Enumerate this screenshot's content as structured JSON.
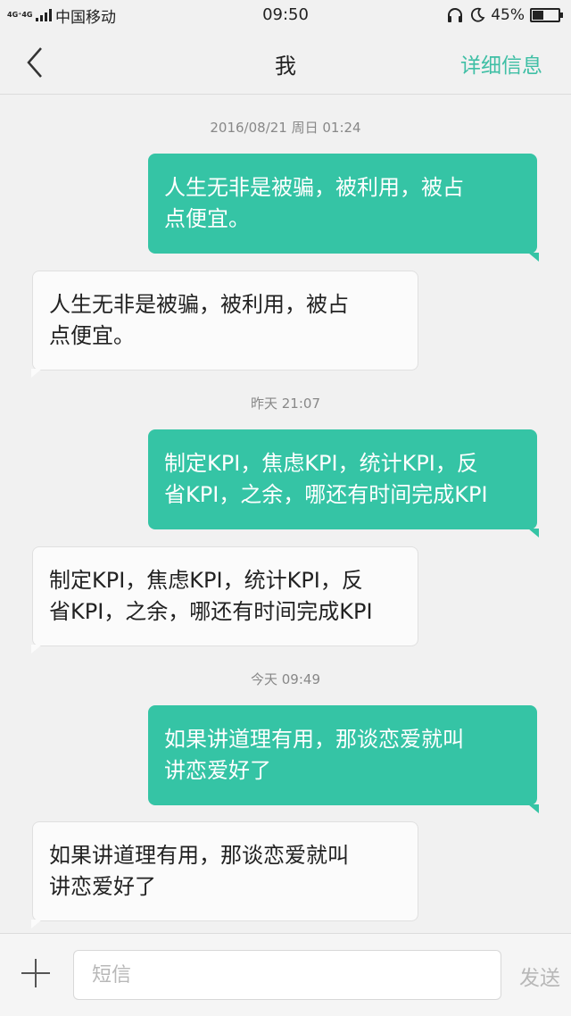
{
  "status_bar": {
    "network": "4G⁺4G",
    "carrier": "中国移动",
    "time": "09:50",
    "battery_percent": "45%",
    "battery_level": 0.45
  },
  "header": {
    "title": "我",
    "detail_label": "详细信息"
  },
  "conversation": [
    {
      "timestamp": "2016/08/21 周日  01:24",
      "sent": [
        "人生无非是被骗，被利用，被占",
        "点便宜。"
      ],
      "received": [
        "人生无非是被骗，被利用，被占",
        "点便宜。"
      ]
    },
    {
      "timestamp": "昨天  21:07",
      "sent": [
        "制定KPI，焦虑KPI，统计KPI，反",
        "省KPI，之余，哪还有时间完成KPI"
      ],
      "received": [
        "制定KPI，焦虑KPI，统计KPI，反",
        "省KPI，之余，哪还有时间完成KPI"
      ]
    },
    {
      "timestamp": "今天  09:49",
      "sent": [
        "如果讲道理有用，那谈恋爱就叫",
        "讲恋爱好了"
      ],
      "received": [
        "如果讲道理有用，那谈恋爱就叫",
        "讲恋爱好了"
      ]
    }
  ],
  "input_bar": {
    "placeholder": "短信",
    "send_label": "发送"
  },
  "colors": {
    "accent": "#35c4a5",
    "link": "#3fbfa5",
    "background": "#f1f1f1"
  }
}
